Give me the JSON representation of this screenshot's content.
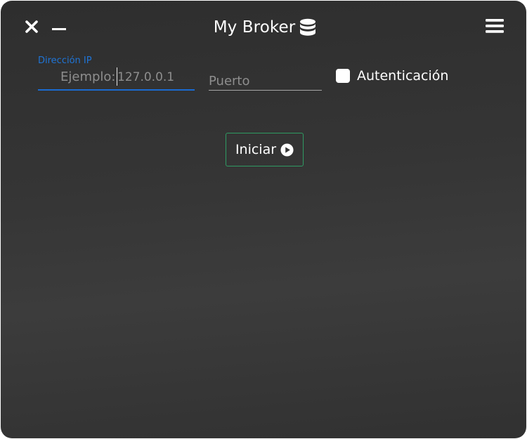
{
  "window": {
    "title": "My Broker",
    "title_icon": "database-icon",
    "controls": {
      "close_icon": "close-icon",
      "minimize_icon": "minimize-icon",
      "menu_icon": "hamburger-menu-icon"
    }
  },
  "form": {
    "ip_field": {
      "label": "Dirección IP",
      "prefix": "Ejemplo:",
      "placeholder": "127.0.0.1",
      "value": "",
      "focused": true
    },
    "port_field": {
      "placeholder": "Puerto",
      "value": ""
    },
    "auth_checkbox": {
      "label": "Autenticación",
      "checked": false
    },
    "start_button": {
      "label": "Iniciar",
      "icon": "play-circle-icon"
    }
  },
  "colors": {
    "background": "#353535",
    "accent_blue": "#1a6bd1",
    "button_border_green": "#2f9b63",
    "placeholder_gray": "#8e8e8e",
    "text_white": "#ffffff"
  }
}
